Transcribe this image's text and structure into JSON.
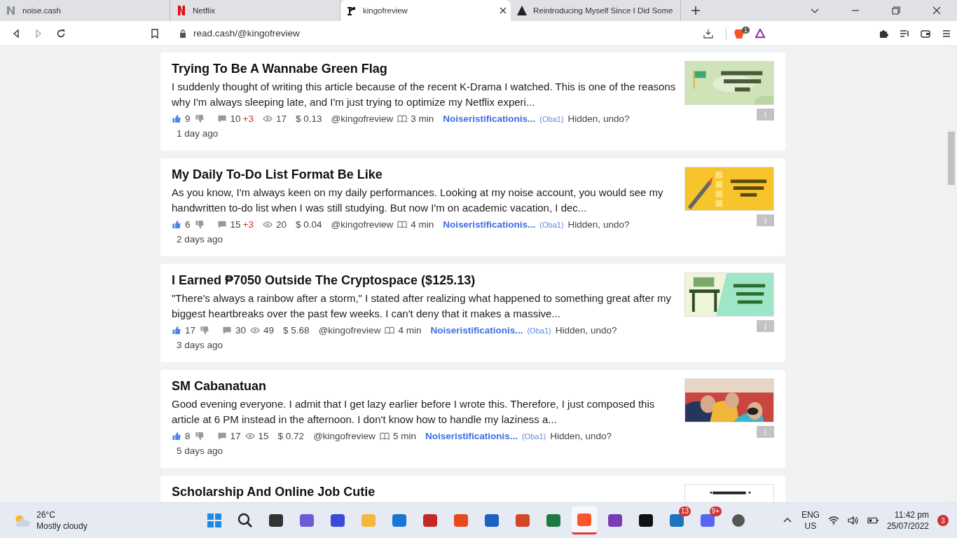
{
  "tabs": [
    {
      "title": "noise.cash",
      "selected": false
    },
    {
      "title": "Netflix",
      "selected": false
    },
    {
      "title": "kingofreview",
      "selected": true
    },
    {
      "title": "Reintroducing Myself Since I Did Some",
      "selected": false
    }
  ],
  "address_bar": {
    "url": "read.cash/@kingofreview"
  },
  "shields_badge": "1",
  "articles": [
    {
      "title": "Trying To Be A Wannabe Green Flag",
      "excerpt": "I suddenly thought of writing this article because of the recent K-Drama I watched. This is one of the reasons why I'm always sleeping late, and I'm just trying to optimize my Netflix experi...",
      "likes": "9",
      "comments": "10",
      "new_comments": "+3",
      "views": "17",
      "earnings": "$ 0.13",
      "author": "@kingofreview",
      "read_time": "3 min",
      "community": "Noiseristificationis...",
      "community_tag": "(Oba1)",
      "hidden_note": "Hidden, undo?",
      "age": "1 day ago"
    },
    {
      "title": "My Daily To-Do List Format Be Like",
      "excerpt": "As you know, I'm always keen on my daily performances. Looking at my noise account, you would see my handwritten to-do list when I was still studying. But now I'm on academic vacation, I dec...",
      "likes": "6",
      "comments": "15",
      "new_comments": "+3",
      "views": "20",
      "earnings": "$ 0.04",
      "author": "@kingofreview",
      "read_time": "4 min",
      "community": "Noiseristificationis...",
      "community_tag": "(Oba1)",
      "hidden_note": "Hidden, undo?",
      "age": "2 days ago"
    },
    {
      "title": "I Earned ₱7050 Outside The Cryptospace ($125.13)",
      "excerpt": "\"There's always a rainbow after a storm,\" I stated after realizing what happened to something great after my biggest heartbreaks over the past few weeks. I can't deny that it makes a massive...",
      "likes": "17",
      "comments": "30",
      "views": "49",
      "earnings": "$ 5.68",
      "author": "@kingofreview",
      "read_time": "4 min",
      "community": "Noiseristificationis...",
      "community_tag": "(Oba1)",
      "hidden_note": "Hidden, undo?",
      "age": "3 days ago"
    },
    {
      "title": "SM Cabanatuan",
      "excerpt": "Good evening everyone. I admit that I get lazy earlier before I wrote this. Therefore, I just composed this article at 6 PM instead in the afternoon. I don't know how to handle my laziness a...",
      "likes": "8",
      "comments": "17",
      "views": "15",
      "earnings": "$ 0.72",
      "author": "@kingofreview",
      "read_time": "5 min",
      "community": "Noiseristificationis...",
      "community_tag": "(Oba1)",
      "hidden_note": "Hidden, undo?",
      "age": "5 days ago"
    },
    {
      "title": "Scholarship And Online Job Cutie"
    }
  ],
  "taskbar": {
    "temperature": "26°C",
    "weather": "Mostly cloudy",
    "apps": [
      {
        "selected": false
      },
      {
        "selected": false
      },
      {
        "selected": false
      },
      {
        "selected": false
      },
      {
        "selected": false
      },
      {
        "selected": false
      },
      {
        "selected": false
      },
      {
        "selected": false
      },
      {
        "selected": false
      },
      {
        "selected": false
      },
      {
        "selected": false
      },
      {
        "selected": false
      },
      {
        "selected": true
      },
      {
        "selected": false
      },
      {
        "selected": false
      },
      {
        "selected": false,
        "badge": "13"
      },
      {
        "selected": false,
        "badge": "9+"
      },
      {
        "selected": false
      }
    ],
    "language": "ENG",
    "region": "US",
    "time": "11:42 pm",
    "date": "25/07/2022",
    "notifications": "3"
  }
}
